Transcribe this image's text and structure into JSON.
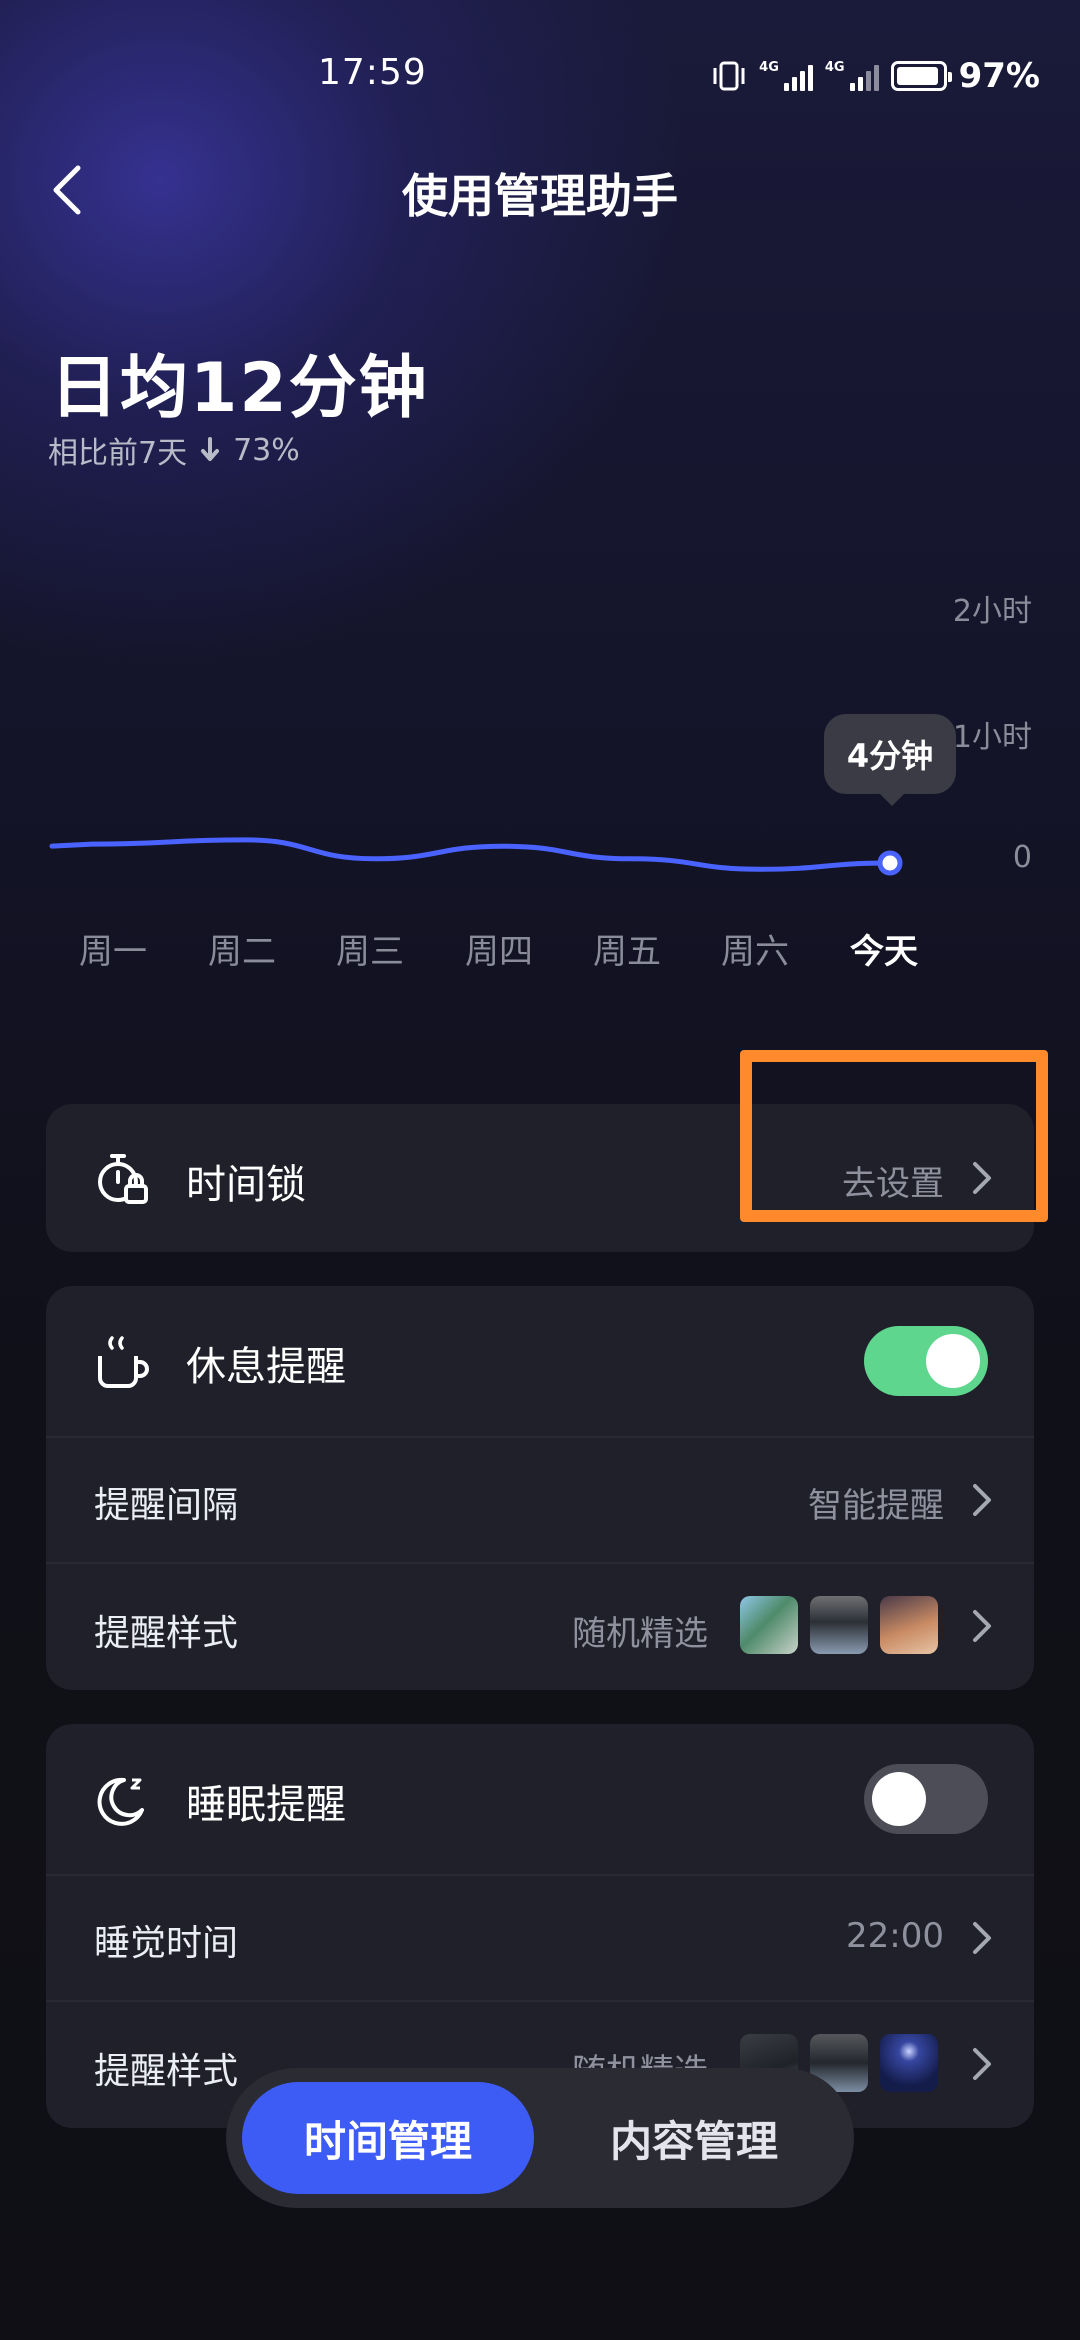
{
  "status_bar": {
    "time": "17:59",
    "battery": "97%",
    "network_1": "4G",
    "network_2": "4G"
  },
  "header": {
    "title": "使用管理助手"
  },
  "summary": {
    "daily_average": "日均12分钟",
    "compare_label": "相比前7天",
    "compare_value": "73%"
  },
  "chart_data": {
    "type": "line",
    "categories": [
      "周一",
      "周二",
      "周三",
      "周四",
      "周五",
      "周六",
      "今天"
    ],
    "values": [
      4.5,
      5.5,
      1,
      4,
      1,
      -1.5,
      0
    ],
    "y_ticks": [
      "2小时",
      "1小时",
      "0"
    ],
    "tooltip": "4分钟",
    "highlight_category": "今天",
    "line_color": "#4a63ff",
    "grid": false
  },
  "time_lock": {
    "title": "时间锁",
    "action": "去设置"
  },
  "rest_reminder": {
    "title": "休息提醒",
    "enabled": true,
    "interval_label": "提醒间隔",
    "interval_value": "智能提醒",
    "style_label": "提醒样式",
    "style_value": "随机精选"
  },
  "sleep_reminder": {
    "title": "睡眠提醒",
    "enabled": false,
    "bedtime_label": "睡觉时间",
    "bedtime_value": "22:00",
    "style_label": "提醒样式",
    "style_value": "随机精选"
  },
  "tabs": [
    {
      "label": "时间管理",
      "active": true
    },
    {
      "label": "内容管理",
      "active": false
    }
  ],
  "colors": {
    "accent": "#3d5bf5",
    "toggle_on": "#5fd68e",
    "highlight": "#ff8a2b"
  }
}
